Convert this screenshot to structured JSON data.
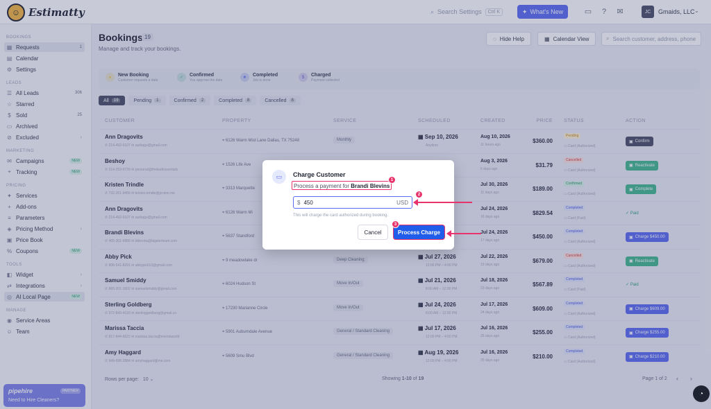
{
  "app": {
    "name": "Estimatty",
    "logo_initial": "☺"
  },
  "topbar": {
    "search_placeholder": "Search Settings",
    "shortcut": "Ctrl K",
    "whats_new": "What's New",
    "avatar_initials": "JC",
    "business": "Gmaids, LLC"
  },
  "sidebar": {
    "sections": [
      {
        "title": "BOOKINGS",
        "items": [
          {
            "label": "Requests",
            "icon": "▦",
            "count": "1",
            "active": true
          },
          {
            "label": "Calendar",
            "icon": "▤"
          },
          {
            "label": "Settings",
            "icon": "⚙"
          }
        ]
      },
      {
        "title": "LEADS",
        "items": [
          {
            "label": "All Leads",
            "icon": "☰",
            "count": "306"
          },
          {
            "label": "Starred",
            "icon": "☆"
          },
          {
            "label": "Sold",
            "icon": "$",
            "count": "25"
          },
          {
            "label": "Archived",
            "icon": "▭"
          },
          {
            "label": "Excluded",
            "icon": "⊘",
            "chevron": "›"
          }
        ]
      },
      {
        "title": "MARKETING",
        "items": [
          {
            "label": "Campaigns",
            "icon": "✉",
            "new": "NEW"
          },
          {
            "label": "Tracking",
            "icon": "⌖",
            "new": "NEW"
          }
        ]
      },
      {
        "title": "PRICING",
        "items": [
          {
            "label": "Services",
            "icon": "✦"
          },
          {
            "label": "Add-ons",
            "icon": "+"
          },
          {
            "label": "Parameters",
            "icon": "≡"
          },
          {
            "label": "Pricing Method",
            "icon": "◈",
            "chevron": "›"
          },
          {
            "label": "Price Book",
            "icon": "▣"
          },
          {
            "label": "Coupons",
            "icon": "%",
            "new": "NEW"
          }
        ]
      },
      {
        "title": "TOOLS",
        "items": [
          {
            "label": "Widget",
            "icon": "◧",
            "chevron": "›"
          },
          {
            "label": "Integrations",
            "icon": "⇄",
            "chevron": "›"
          },
          {
            "label": "AI Local Page",
            "icon": "◎",
            "new": "NEW",
            "active": true
          }
        ]
      },
      {
        "title": "MANAGE",
        "items": [
          {
            "label": "Service Areas",
            "icon": "◉"
          },
          {
            "label": "Team",
            "icon": "☺"
          }
        ]
      }
    ],
    "promo": {
      "brand": "pipehire",
      "tag": "PARTNER",
      "text": "Need to Hire Cleaners?"
    }
  },
  "header": {
    "title": "Bookings",
    "count": "19",
    "subtitle": "Manage and track your bookings.",
    "hide_help": "Hide Help",
    "calendar_view": "Calendar View",
    "search_placeholder": "Search customer, address, phone"
  },
  "steps": [
    {
      "title": "New Booking",
      "desc": "Customer requests a date",
      "color": "#f2c94c",
      "icon": "●"
    },
    {
      "title": "Confirmed",
      "desc": "You approve the date",
      "color": "#43b98f",
      "icon": "✓"
    },
    {
      "title": "Completed",
      "desc": "Job is done",
      "color": "#5b6cf2",
      "icon": "★"
    },
    {
      "title": "Charged",
      "desc": "Payment collected",
      "color": "#7a64d6",
      "icon": "$"
    }
  ],
  "filters": [
    {
      "label": "All",
      "count": "19",
      "on": true
    },
    {
      "label": "Pending",
      "count": "1"
    },
    {
      "label": "Confirmed",
      "count": "2"
    },
    {
      "label": "Completed",
      "count": "8"
    },
    {
      "label": "Cancelled",
      "count": "8"
    }
  ],
  "table": {
    "columns": [
      "CUSTOMER",
      "PROPERTY",
      "SERVICE",
      "SCHEDULED",
      "CREATED",
      "PRICE",
      "STATUS",
      "ACTION"
    ],
    "rows": [
      {
        "name": "Ann Dragovits",
        "phone": "214-492-6107",
        "email": "asdrago@gmail.com",
        "property": "6126 Warm Mist Lane Dallas, TX 75248",
        "service": "Monthly",
        "date": "Sep 10, 2026",
        "time": "Anytime",
        "created": "Aug 10, 2026",
        "ago": "11 hours ago",
        "price": "$360.00",
        "status": "Pending",
        "pay": "Card (Authorized)",
        "action": "Confirm",
        "action_color": "#4a5066"
      },
      {
        "name": "Beshoy",
        "phone": "214-253-0739",
        "email": "personal@theleafessentials",
        "property": "1526 Life Ave",
        "service": "",
        "date": "",
        "time": "",
        "created": "Aug 3, 2026",
        "ago": "6 days ago",
        "price": "$31.79",
        "status": "Cancelled",
        "pay": "Card (Authorized)",
        "action": "Reactivate",
        "action_color": "#43b98f"
      },
      {
        "name": "Kristen Trindle",
        "phone": "732-261-9456",
        "email": "kristen.trindle@proton.me",
        "property": "3313 Marquette",
        "service": "",
        "date": "",
        "time": "",
        "created": "Jul 30, 2026",
        "ago": "11 days ago",
        "price": "$189.00",
        "status": "Confirmed",
        "pay": "Card (Authorized)",
        "action": "Complete",
        "action_color": "#43b98f"
      },
      {
        "name": "Ann Dragovits",
        "phone": "214-492-6107",
        "email": "asdrago@gmail.com",
        "property": "6126 Warm Mi",
        "service": "",
        "date": "",
        "time": "",
        "created": "Jul 24, 2026",
        "ago": "16 days ago",
        "price": "$829.54",
        "status": "Completed",
        "pay": "Card (Paid)",
        "action": "Paid",
        "paid": true
      },
      {
        "name": "Brandi Blevins",
        "phone": "405-301-6886",
        "email": "bblevins@bigsterteam.com",
        "property": "5637 Standford",
        "service": "",
        "date": "",
        "time": "",
        "created": "Jul 24, 2026",
        "ago": "17 days ago",
        "price": "$450.00",
        "status": "Completed",
        "pay": "Card (Authorized)",
        "action": "Charge $450.00",
        "action_color": "#5b6cf2"
      },
      {
        "name": "Abby Pick",
        "phone": "806-541-8291",
        "email": "abbypick10@gmail.com",
        "property": "9 meadowlake dr",
        "service": "Deep Cleaning",
        "date": "Jul 27, 2026",
        "time": "12:00 PM – 4:00 PM",
        "created": "Jul 22, 2026",
        "ago": "19 days ago",
        "price": "$679.00",
        "status": "Cancelled",
        "pay": "Card (Authorized)",
        "action": "Reactivate",
        "action_color": "#43b98f"
      },
      {
        "name": "Samuel Smiddy",
        "phone": "865-201-1602",
        "email": "samuelsmiddy@gmail.com",
        "property": "6024 Hudson St",
        "service": "Move In/Out",
        "date": "Jul 21, 2026",
        "time": "8:00 AM – 12:00 PM",
        "created": "Jul 18, 2026",
        "ago": "23 days ago",
        "price": "$567.89",
        "status": "Completed",
        "pay": "Card (Paid)",
        "action": "Paid",
        "paid": true
      },
      {
        "name": "Sterling Goldberg",
        "phone": "972-849-4193",
        "email": "sterlinggoldberg@gmail.co",
        "property": "17230 Marianne Circle",
        "service": "Move In/Out",
        "date": "Jul 24, 2026",
        "time": "8:00 AM – 12:00 PM",
        "created": "Jul 17, 2026",
        "ago": "24 days ago",
        "price": "$609.00",
        "status": "Completed",
        "pay": "Card (Authorized)",
        "action": "Charge $609.00",
        "action_color": "#5b6cf2"
      },
      {
        "name": "Marissa Taccia",
        "phone": "817-844-6622",
        "email": "marissa.taccia@eventsworld",
        "property": "5901 Auburndale Avenue",
        "service": "General / Standard Cleaning",
        "date": "Jul 17, 2026",
        "time": "12:00 PM – 4:00 PM",
        "created": "Jul 16, 2026",
        "ago": "25 days ago",
        "price": "$255.00",
        "status": "Completed",
        "pay": "Card (Authorized)",
        "action": "Charge $255.00",
        "action_color": "#5b6cf2"
      },
      {
        "name": "Amy Haggard",
        "phone": "949-698-2884",
        "email": "amyhaggard@me.com",
        "property": "5609 Smu Blvd",
        "service": "General / Standard Cleaning",
        "date": "Aug 19, 2026",
        "time": "12:00 PM – 4:00 PM",
        "created": "Jul 16, 2026",
        "ago": "25 days ago",
        "price": "$210.00",
        "status": "Completed",
        "pay": "Card (Authorized)",
        "action": "Charge $210.00",
        "action_color": "#5b6cf2"
      }
    ],
    "status_colors": {
      "Pending": [
        "#fdf1d6",
        "#c98a12"
      ],
      "Cancelled": [
        "#fde1e1",
        "#d0443e"
      ],
      "Confirmed": [
        "#d9f3e8",
        "#2a9a6e"
      ],
      "Completed": [
        "#e2e6fd",
        "#4a5ee0"
      ]
    }
  },
  "footer": {
    "rows_per_page": "Rows per page:",
    "rows_value": "10",
    "showing_prefix": "Showing ",
    "showing_range": "1-10",
    "showing_of": " of ",
    "showing_total": "19",
    "page": "Page 1 of 2"
  },
  "modal": {
    "title": "Charge Customer",
    "subtitle_prefix": "Process a payment for ",
    "customer": "Brandi Blevins",
    "currency_symbol": "$",
    "amount": "450",
    "currency": "USD",
    "note": "This will charge the card authorized during booking.",
    "cancel": "Cancel",
    "process": "Process Charge"
  },
  "annotations": [
    "1",
    "2",
    "3"
  ],
  "colors": {
    "accent": "#5b6cf2",
    "primary_button": "#1f5dea",
    "annotation": "#e8336d"
  }
}
